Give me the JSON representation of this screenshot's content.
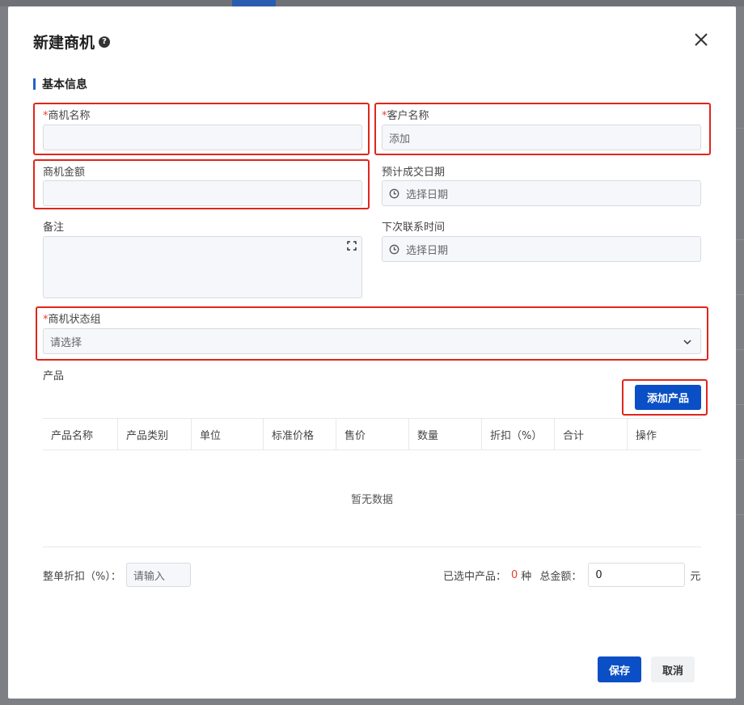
{
  "background": {
    "active_tab_color": "#2a5db0"
  },
  "modal": {
    "title": "新建商机",
    "section_title": "基本信息",
    "fields": {
      "opportunity_name": {
        "required_mark": "*",
        "label": "商机名称",
        "value": ""
      },
      "customer_name": {
        "required_mark": "*",
        "label": "客户名称",
        "value": "添加"
      },
      "amount": {
        "label": "商机金额",
        "value": ""
      },
      "expected_close_date": {
        "label": "预计成交日期",
        "placeholder": "选择日期"
      },
      "remark": {
        "label": "备注",
        "value": ""
      },
      "next_contact_time": {
        "label": "下次联系时间",
        "placeholder": "选择日期"
      },
      "status_group": {
        "required_mark": "*",
        "label": "商机状态组",
        "placeholder": "请选择"
      }
    },
    "products": {
      "label": "产品",
      "add_button": "添加产品",
      "columns": [
        "产品名称",
        "产品类别",
        "单位",
        "标准价格",
        "售价",
        "数量",
        "折扣（%）",
        "合计",
        "操作"
      ],
      "empty_text": "暂无数据"
    },
    "footer": {
      "discount_label": "整单折扣（%）：",
      "discount_placeholder": "请输入",
      "selected_label": "已选中产品：",
      "selected_count": "0",
      "selected_unit": "种",
      "total_label": "总金额：",
      "total_value": "0",
      "currency_unit": "元"
    },
    "buttons": {
      "save": "保存",
      "cancel": "取消"
    }
  },
  "colors": {
    "primary": "#0a4fc5",
    "highlight": "#e1251b",
    "required": "#e5402b"
  }
}
